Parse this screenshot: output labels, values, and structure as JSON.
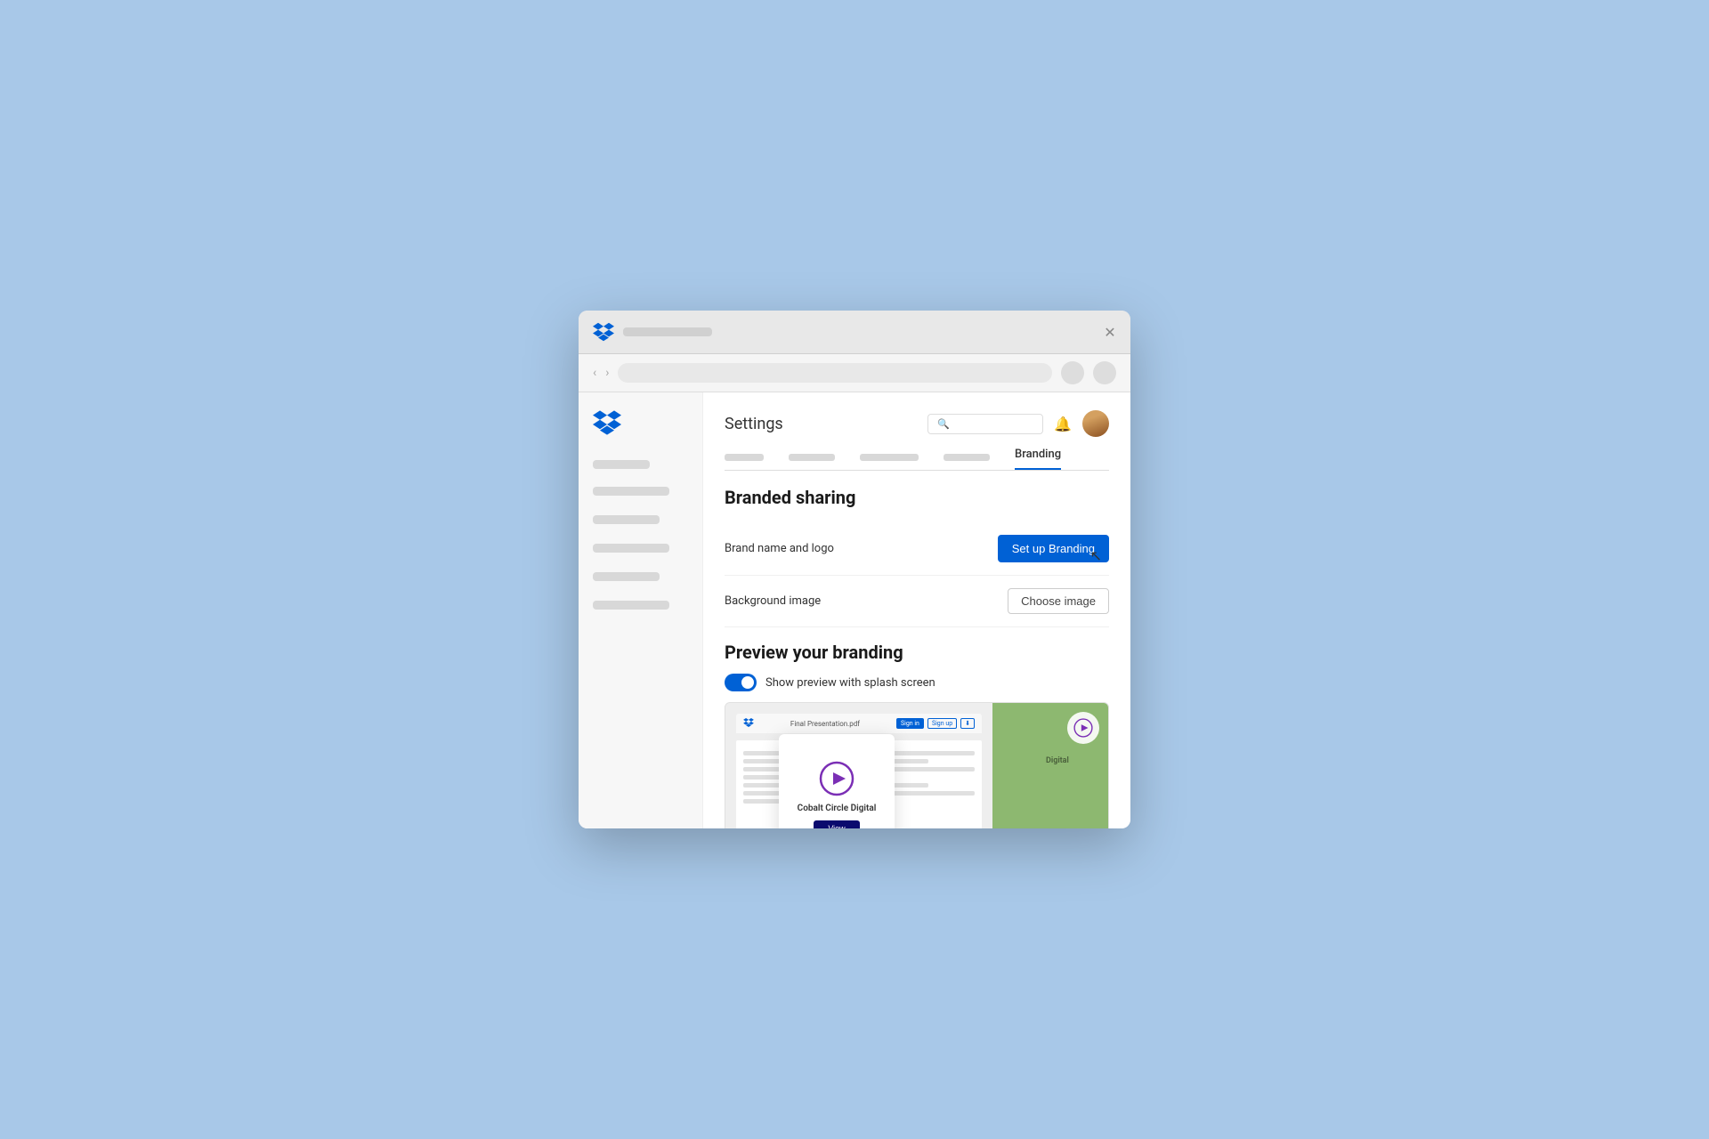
{
  "browser": {
    "close_label": "✕",
    "nav_back": "‹",
    "nav_forward": "›"
  },
  "sidebar": {
    "placeholder_items": [
      "",
      "",
      "",
      "",
      ""
    ]
  },
  "settings": {
    "title": "Settings",
    "search_placeholder": "Search",
    "active_tab": "Branding",
    "tabs_placeholder": [
      "",
      "",
      "",
      "",
      ""
    ],
    "section": {
      "branded_sharing_title": "Branded sharing",
      "brand_name_logo_label": "Brand name and logo",
      "setup_branding_btn": "Set up Branding",
      "background_image_label": "Background image",
      "choose_image_btn": "Choose image"
    },
    "preview": {
      "title": "Preview your branding",
      "toggle_label": "Show preview with splash screen",
      "toggle_on": true,
      "topbar_filename": "Final Presentation.pdf",
      "topbar_signin": "Sign in",
      "topbar_signup": "Sign up",
      "splash_company": "Cobalt Circle Digital",
      "splash_view_btn": "View",
      "right_section_label": "Digital"
    }
  }
}
